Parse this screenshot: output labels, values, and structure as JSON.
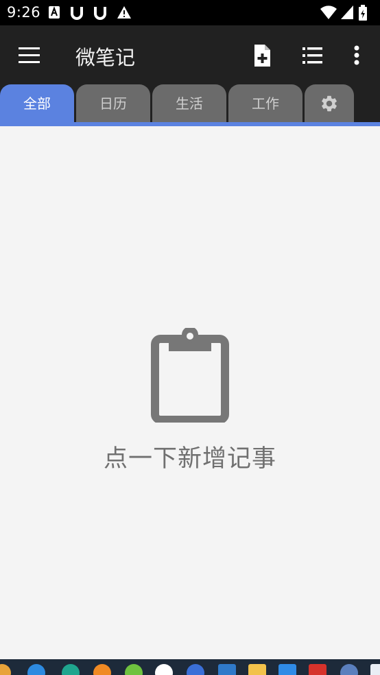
{
  "status_bar": {
    "time": "9:26"
  },
  "app_bar": {
    "menu_icon": "menu-icon",
    "title": "微笔记",
    "actions": [
      "add-note-icon",
      "list-icon",
      "more-vert-icon"
    ]
  },
  "tabs": [
    {
      "label": "全部",
      "active": true
    },
    {
      "label": "日历",
      "active": false
    },
    {
      "label": "生活",
      "active": false
    },
    {
      "label": "工作",
      "active": false
    },
    {
      "label": "",
      "icon": "gear-icon",
      "active": false
    }
  ],
  "empty_state": {
    "icon": "clipboard-icon",
    "message": "点一下新增记事"
  },
  "colors": {
    "app_bar_bg": "#212121",
    "accent": "#5b82e0",
    "tab_inactive": "#6b6b6b",
    "content_bg": "#f4f4f4",
    "empty_icon": "#777777"
  }
}
